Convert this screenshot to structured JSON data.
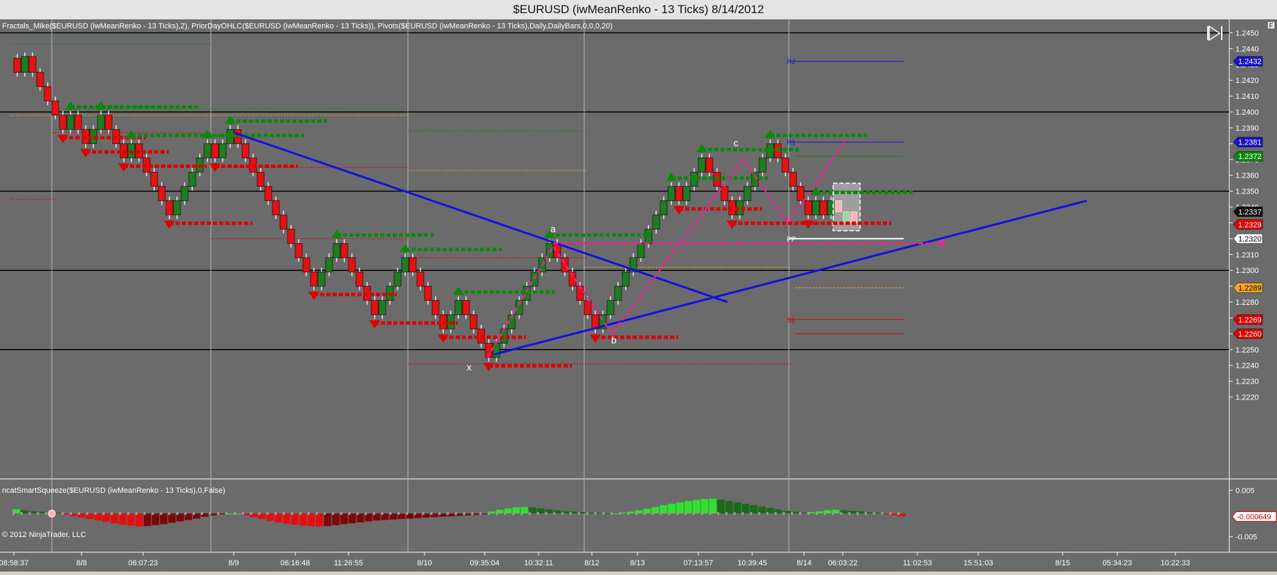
{
  "window": {
    "title": "$EURUSD (iwMeanRenko - 13 Ticks)  8/14/2012"
  },
  "chart": {
    "indicator_label": "Fractals_Mike($EURUSD (iwMeanRenko - 13 Ticks),2), PriorDayOHLC($EURUSD (iwMeanRenko - 13 Ticks)), Pivots($EURUSD (iwMeanRenko - 13 Ticks),Daily,DailyBars,0,0,0,20)",
    "oscillator_label": "ncatSmartSqueeze($EURUSD (iwMeanRenko - 13 Ticks),0,False)",
    "copyright": "© 2012 NinjaTrader, LLC",
    "corner_button": "F",
    "colors": {
      "background": "#6b6b6b",
      "up_brick": "#1e7d1e",
      "down_brick": "#e81010",
      "trendline": "#1010e0",
      "pattern": "#ff1a9a",
      "fractal_up": "#0a8a0a",
      "fractal_down": "#e00000"
    }
  },
  "chart_data": [
    {
      "type": "candlestick",
      "series_name": "",
      "y_axis": {
        "range": [
          1.2215,
          1.2455
        ],
        "ticks": [
          "1.2450",
          "1.2440",
          "1.2430",
          "1.2420",
          "1.2410",
          "1.2400",
          "1.2390",
          "1.2380",
          "1.2370",
          "1.2360",
          "1.2350",
          "1.2340",
          "1.2330",
          "1.2320",
          "1.2310",
          "1.2300",
          "1.2290",
          "1.2280",
          "1.2270",
          "1.2260",
          "1.2250",
          "1.2240",
          "1.2230",
          "1.2220"
        ]
      },
      "x_axis": {
        "labels": [
          "08:58:37",
          "8/8",
          "06:07:23",
          "8/9",
          "06:16:48",
          "11:26:55",
          "8/10",
          "09:35:04",
          "10:32:11",
          "8/12",
          "8/13",
          "07:13:57",
          "10:39:45",
          "8/14",
          "06:03:22",
          "11:02:53",
          "15:51:03",
          "8/15",
          "05:34:23",
          "10:22:33"
        ]
      },
      "closes": [
        1.2425,
        1.2435,
        1.2425,
        1.2416,
        1.2407,
        1.2398,
        1.2389,
        1.2398,
        1.2389,
        1.238,
        1.2389,
        1.2398,
        1.2389,
        1.238,
        1.2371,
        1.238,
        1.2371,
        1.2362,
        1.2353,
        1.2344,
        1.2335,
        1.2344,
        1.2353,
        1.2362,
        1.2371,
        1.238,
        1.2371,
        1.238,
        1.2389,
        1.238,
        1.2371,
        1.2362,
        1.2353,
        1.2344,
        1.2335,
        1.2326,
        1.2317,
        1.2308,
        1.2299,
        1.229,
        1.2299,
        1.2308,
        1.2317,
        1.2308,
        1.2299,
        1.229,
        1.2281,
        1.2272,
        1.2281,
        1.229,
        1.2299,
        1.2308,
        1.2299,
        1.229,
        1.2281,
        1.2272,
        1.2263,
        1.2272,
        1.2281,
        1.2272,
        1.2263,
        1.2254,
        1.2245,
        1.2254,
        1.2263,
        1.2272,
        1.2281,
        1.229,
        1.2299,
        1.2308,
        1.2317,
        1.2308,
        1.2299,
        1.229,
        1.2281,
        1.2272,
        1.2263,
        1.2272,
        1.2281,
        1.229,
        1.2299,
        1.2308,
        1.2317,
        1.2326,
        1.2335,
        1.2344,
        1.2353,
        1.2344,
        1.2353,
        1.2362,
        1.2371,
        1.2362,
        1.2353,
        1.2344,
        1.2335,
        1.2344,
        1.2353,
        1.2362,
        1.2371,
        1.238,
        1.2371,
        1.2362,
        1.2353,
        1.2344,
        1.2335,
        1.2344,
        1.2335,
        1.2344
      ],
      "last_bars": [
        1.2337,
        1.233,
        1.2337
      ],
      "price_markers": [
        {
          "value": 1.2432,
          "label": "1.2432",
          "color": "#1414d2",
          "text_color": "#ffffff"
        },
        {
          "value": 1.2381,
          "label": "1.2381",
          "color": "#1414d2",
          "text_color": "#ffffff"
        },
        {
          "value": 1.2372,
          "label": "1.2372",
          "color": "#0a8a0a",
          "text_color": "#ffffff"
        },
        {
          "value": 1.2337,
          "label": "1.2337",
          "color": "#101010",
          "text_color": "#ffffff"
        },
        {
          "value": 1.2329,
          "label": "1.2329",
          "color": "#e00000",
          "text_color": "#ffffff"
        },
        {
          "value": 1.232,
          "label": "1.2320",
          "color": "#ffffff",
          "text_color": "#000000"
        },
        {
          "value": 1.2289,
          "label": "1.2289",
          "color": "#f5a623",
          "text_color": "#000000"
        },
        {
          "value": 1.2269,
          "label": "1.2269",
          "color": "#e00000",
          "text_color": "#ffffff"
        },
        {
          "value": 1.226,
          "label": "1.2260",
          "color": "#e00000",
          "text_color": "#ffffff"
        }
      ],
      "pivot_labels": [
        {
          "label": "R2",
          "value": 1.2432
        },
        {
          "label": "R1",
          "value": 1.2381
        },
        {
          "label": "PP",
          "value": 1.232
        },
        {
          "label": "S1",
          "value": 1.2269
        }
      ],
      "pattern_labels": [
        {
          "label": "x",
          "value": 1.2243
        },
        {
          "label": "a",
          "value": 1.2318
        },
        {
          "label": "b",
          "value": 1.226
        },
        {
          "label": "c",
          "value": 1.2375
        }
      ]
    },
    {
      "type": "bar",
      "series_name": "",
      "y_axis": {
        "ticks": [
          "0.005",
          "-0.005"
        ],
        "range": [
          -0.0055,
          0.0055
        ]
      },
      "last_value_marker": {
        "value": -0.000649,
        "label": "-0.000649"
      },
      "values": [
        0.0009,
        0.0007,
        0.0005,
        0.0004,
        0.0003,
        0.0002,
        -0.0003,
        -0.0006,
        -0.0009,
        -0.0012,
        -0.0015,
        -0.0018,
        -0.0021,
        -0.0024,
        -0.0026,
        -0.0028,
        -0.0027,
        -0.0025,
        -0.0023,
        -0.002,
        -0.0017,
        -0.0014,
        -0.0011,
        -0.0007,
        -0.0004,
        -0.0002,
        0.0,
        0.0,
        -0.0004,
        -0.0008,
        -0.0012,
        -0.0016,
        -0.0019,
        -0.0022,
        -0.0024,
        -0.0026,
        -0.0027,
        -0.0028,
        -0.0027,
        -0.0025,
        -0.0023,
        -0.0021,
        -0.0019,
        -0.0017,
        -0.0015,
        -0.0014,
        -0.0013,
        -0.0012,
        -0.0011,
        -0.001,
        -0.0009,
        -0.0008,
        -0.0007,
        -0.0006,
        -0.0005,
        -0.0004,
        -0.0003,
        -0.0002,
        0.0004,
        0.0008,
        0.0011,
        0.0013,
        0.0014,
        0.0013,
        0.0011,
        0.0009,
        0.0007,
        0.0005,
        0.0004,
        0.0003,
        0.0002,
        0.0001,
        0.0,
        0.0,
        0.0002,
        0.0004,
        0.0007,
        0.001,
        0.0014,
        0.0018,
        0.0021,
        0.0024,
        0.0027,
        0.0029,
        0.0031,
        0.0032,
        0.003,
        0.0027,
        0.0024,
        0.0021,
        0.0018,
        0.0015,
        0.0012,
        0.0009,
        0.0006,
        0.0004,
        0.0002,
        0.0003,
        0.0005,
        0.0007,
        0.0008,
        0.0007,
        0.0006,
        0.0005,
        0.0003,
        0.0002,
        -0.0002,
        -0.0004,
        -0.0006
      ]
    }
  ]
}
